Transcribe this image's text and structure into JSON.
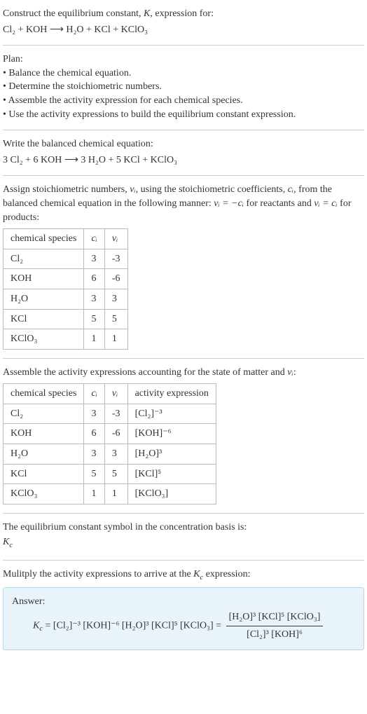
{
  "header": {
    "line1": "Construct the equilibrium constant, ",
    "K": "K",
    "line1b": ", expression for:",
    "eq_lhs": "Cl₂ + KOH",
    "eq_arrow": "⟶",
    "eq_rhs": "H₂O + KCl + KClO₃"
  },
  "plan": {
    "title": "Plan:",
    "b1": "• Balance the chemical equation.",
    "b2": "• Determine the stoichiometric numbers.",
    "b3": "• Assemble the activity expression for each chemical species.",
    "b4": "• Use the activity expressions to build the equilibrium constant expression."
  },
  "balanced": {
    "title": "Write the balanced chemical equation:",
    "lhs": "3 Cl₂ + 6 KOH",
    "arrow": "⟶",
    "rhs": "3 H₂O + 5 KCl + KClO₃"
  },
  "stoich": {
    "intro1": "Assign stoichiometric numbers, ",
    "nu": "νᵢ",
    "intro2": ", using the stoichiometric coefficients, ",
    "ci": "cᵢ",
    "intro3": ", from the balanced chemical equation in the following manner: ",
    "rel1": "νᵢ = −cᵢ",
    "intro4": " for reactants and ",
    "rel2": "νᵢ = cᵢ",
    "intro5": " for products:",
    "h_species": "chemical species",
    "h_ci": "cᵢ",
    "h_nu": "νᵢ",
    "rows": [
      {
        "sp": "Cl₂",
        "c": "3",
        "n": "-3"
      },
      {
        "sp": "KOH",
        "c": "6",
        "n": "-6"
      },
      {
        "sp": "H₂O",
        "c": "3",
        "n": "3"
      },
      {
        "sp": "KCl",
        "c": "5",
        "n": "5"
      },
      {
        "sp": "KClO₃",
        "c": "1",
        "n": "1"
      }
    ]
  },
  "activity": {
    "title": "Assemble the activity expressions accounting for the state of matter and ",
    "nu": "νᵢ",
    "colon": ":",
    "h_species": "chemical species",
    "h_ci": "cᵢ",
    "h_nu": "νᵢ",
    "h_act": "activity expression",
    "rows": [
      {
        "sp": "Cl₂",
        "c": "3",
        "n": "-3",
        "a": "[Cl₂]⁻³"
      },
      {
        "sp": "KOH",
        "c": "6",
        "n": "-6",
        "a": "[KOH]⁻⁶"
      },
      {
        "sp": "H₂O",
        "c": "3",
        "n": "3",
        "a": "[H₂O]³"
      },
      {
        "sp": "KCl",
        "c": "5",
        "n": "5",
        "a": "[KCl]⁵"
      },
      {
        "sp": "KClO₃",
        "c": "1",
        "n": "1",
        "a": "[KClO₃]"
      }
    ]
  },
  "basis": {
    "line1": "The equilibrium constant symbol in the concentration basis is:",
    "line2": "K",
    "sub": "c"
  },
  "final": {
    "title": "Mulitply the activity expressions to arrive at the ",
    "Kc": "K",
    "sub_c": "c",
    "title_end": " expression:",
    "answer_label": "Answer:",
    "Kc2": "K",
    "sub_c2": "c",
    "eq": " = [Cl₂]⁻³ [KOH]⁻⁶ [H₂O]³ [KCl]⁵ [KClO₃] = ",
    "num": "[H₂O]³ [KCl]⁵ [KClO₃]",
    "den": "[Cl₂]³ [KOH]⁶"
  },
  "chart_data": {
    "type": "table",
    "tables": [
      {
        "title": "Stoichiometric numbers",
        "columns": [
          "chemical species",
          "c_i",
          "ν_i"
        ],
        "rows": [
          [
            "Cl₂",
            3,
            -3
          ],
          [
            "KOH",
            6,
            -6
          ],
          [
            "H₂O",
            3,
            3
          ],
          [
            "KCl",
            5,
            5
          ],
          [
            "KClO₃",
            1,
            1
          ]
        ]
      },
      {
        "title": "Activity expressions",
        "columns": [
          "chemical species",
          "c_i",
          "ν_i",
          "activity expression"
        ],
        "rows": [
          [
            "Cl₂",
            3,
            -3,
            "[Cl₂]^-3"
          ],
          [
            "KOH",
            6,
            -6,
            "[KOH]^-6"
          ],
          [
            "H₂O",
            3,
            3,
            "[H₂O]^3"
          ],
          [
            "KCl",
            5,
            5,
            "[KCl]^5"
          ],
          [
            "KClO₃",
            1,
            1,
            "[KClO₃]"
          ]
        ]
      }
    ]
  }
}
